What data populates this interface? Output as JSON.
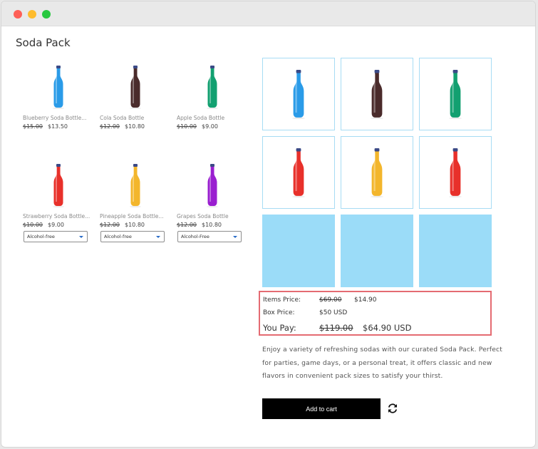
{
  "window": {
    "title": ""
  },
  "page": {
    "title": "Soda Pack"
  },
  "products": [
    {
      "name": "Blueberry Soda Bottle...",
      "old_price": "$15.00",
      "price": "$13.50",
      "color": "#2a9be8"
    },
    {
      "name": "Cola Soda Bottle",
      "old_price": "$12.00",
      "price": "$10.80",
      "color": "#4a2b2b"
    },
    {
      "name": "Apple Soda Bottle",
      "old_price": "$10.00",
      "price": "$9.00",
      "color": "#12a070"
    },
    {
      "name": "Strawberry Soda Bottle...",
      "old_price": "$10.00",
      "price": "$9.00",
      "color": "#e8302a",
      "option": "Alcohol-free"
    },
    {
      "name": "Pineapple Soda Bottle...",
      "old_price": "$12.00",
      "price": "$10.80",
      "color": "#f3b62c",
      "option": "Alcohol-free"
    },
    {
      "name": "Grapes Soda Bottle",
      "old_price": "$12.00",
      "price": "$10.80",
      "color": "#9a1fd0",
      "option": "Alcohol-Free"
    }
  ],
  "box": {
    "filled": [
      {
        "color": "#2a9be8"
      },
      {
        "color": "#4a2b2b"
      },
      {
        "color": "#12a070"
      },
      {
        "color": "#e8302a"
      },
      {
        "color": "#f3b62c"
      },
      {
        "color": "#e8302a"
      }
    ],
    "empty_slots": 3,
    "empty_color": "#9bdcf8"
  },
  "summary": {
    "items_label": "Items Price:",
    "items_old": "$69.00",
    "items_new": "$14.90",
    "box_label": "Box Price:",
    "box_value": "$50 USD",
    "pay_label": "You Pay:",
    "pay_old": "$119.00",
    "pay_new": "$64.90 USD"
  },
  "description": "Enjoy a variety of refreshing sodas with our curated Soda Pack. Perfect for parties, game days, or a personal treat, it offers classic and new flavors in convenient pack sizes to satisfy your thirst.",
  "cart": {
    "add_label": "Add to cart"
  },
  "colors": {
    "highlight_border": "#e46b72",
    "cell_border": "#a7dcf4",
    "button_bg": "#000000"
  }
}
